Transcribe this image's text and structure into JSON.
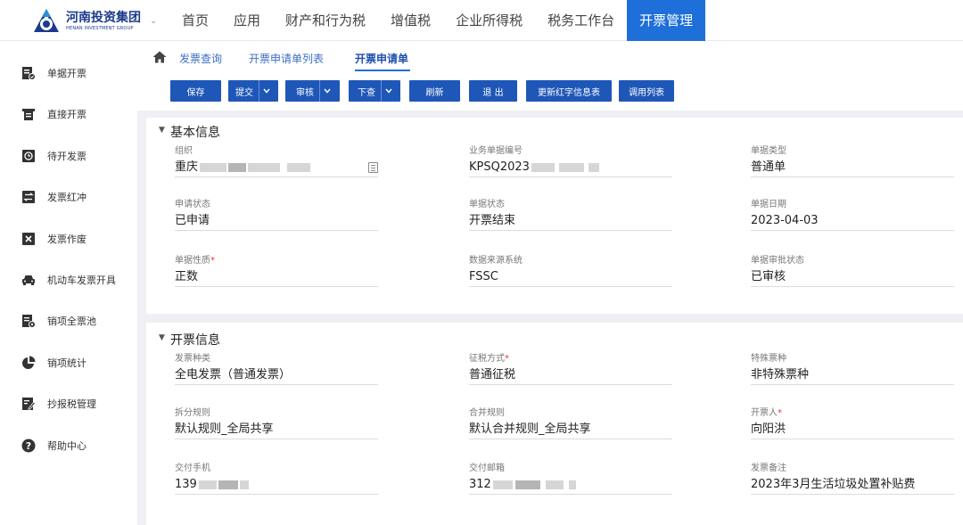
{
  "brand": {
    "name_cn": "河南投资集团",
    "name_en": "HENAN INVESTMENT GROUP",
    "color": "#1b3a8c"
  },
  "nav": {
    "items": [
      {
        "label": "首页"
      },
      {
        "label": "应用"
      },
      {
        "label": "财产和行为税"
      },
      {
        "label": "增值税"
      },
      {
        "label": "企业所得税"
      },
      {
        "label": "税务工作台"
      },
      {
        "label": "开票管理",
        "active": true
      }
    ],
    "active_color": "#1e6fd9"
  },
  "sidebar": {
    "items": [
      {
        "label": "单据开票",
        "icon": "document-check-icon"
      },
      {
        "label": "直接开票",
        "icon": "printer-icon"
      },
      {
        "label": "待开发票",
        "icon": "clock-icon"
      },
      {
        "label": "发票红冲",
        "icon": "swap-icon"
      },
      {
        "label": "发票作废",
        "icon": "x-box-icon"
      },
      {
        "label": "机动车发票开具",
        "icon": "car-icon"
      },
      {
        "label": "销项全票池",
        "icon": "document-settings-icon"
      },
      {
        "label": "销项统计",
        "icon": "pie-chart-icon"
      },
      {
        "label": "抄报税管理",
        "icon": "edit-document-icon"
      },
      {
        "label": "帮助中心",
        "icon": "help-icon"
      }
    ]
  },
  "breadcrumb": {
    "items": [
      {
        "label": "发票查询"
      },
      {
        "label": "开票申请单列表"
      },
      {
        "label": "开票申请单",
        "active": true
      }
    ]
  },
  "toolbar": {
    "save": "保存",
    "submit": "提交",
    "review": "审核",
    "next_query": "下查",
    "refresh": "刷新",
    "exit": "退 出",
    "update_red": "更新红字信息表",
    "call_list": "调用列表",
    "button_color": "#1e57b8"
  },
  "basic_info": {
    "title": "基本信息",
    "fields": {
      "org": {
        "label": "组织",
        "value": "重庆"
      },
      "biz_no": {
        "label": "业务单据编号",
        "value": "KPSQ2023"
      },
      "doc_type": {
        "label": "单据类型",
        "value": "普通单"
      },
      "apply_status": {
        "label": "申请状态",
        "value": "已申请"
      },
      "doc_status": {
        "label": "单据状态",
        "value": "开票结束"
      },
      "doc_date": {
        "label": "单据日期",
        "value": "2023-04-03"
      },
      "doc_nature": {
        "label": "单据性质",
        "value": "正数"
      },
      "data_source": {
        "label": "数据来源系统",
        "value": "FSSC"
      },
      "approval_status": {
        "label": "单据审批状态",
        "value": "已审核"
      }
    }
  },
  "invoice_info": {
    "title": "开票信息",
    "fields": {
      "invoice_type": {
        "label": "发票种类",
        "value": "全电发票（普通发票）"
      },
      "tax_method": {
        "label": "征税方式",
        "value": "普通征税"
      },
      "special_type": {
        "label": "特殊票种",
        "value": "非特殊票种"
      },
      "split_rule": {
        "label": "拆分规则",
        "value": "默认规则_全局共享"
      },
      "merge_rule": {
        "label": "合并规则",
        "value": "默认合并规则_全局共享"
      },
      "issuer": {
        "label": "开票人",
        "value": "向阳洪"
      },
      "phone": {
        "label": "交付手机",
        "value": "139"
      },
      "email": {
        "label": "交付邮箱",
        "value": "312"
      },
      "remark": {
        "label": "发票备注",
        "value": "2023年3月生活垃圾处置补贴费"
      }
    }
  },
  "required_mark": "*"
}
